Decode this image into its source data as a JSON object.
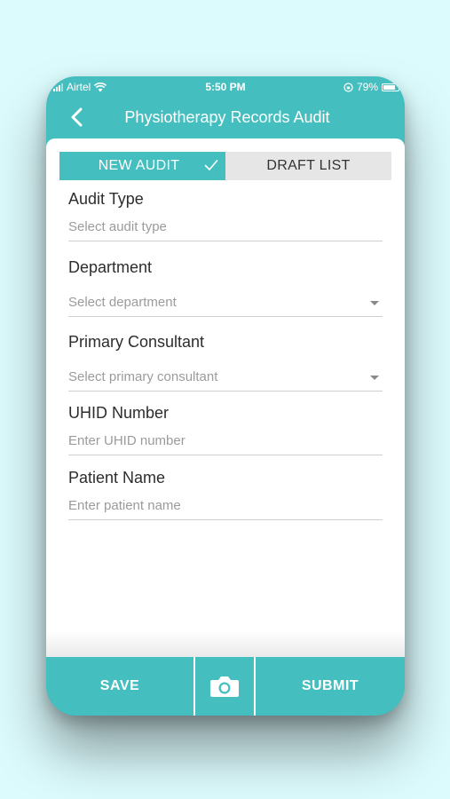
{
  "status_bar": {
    "carrier": "Airtel",
    "time": "5:50 PM",
    "battery": "79%",
    "battery_level": 0.79
  },
  "nav": {
    "title": "Physiotherapy Records Audit",
    "back_icon": "chevron-left-icon"
  },
  "tabs": {
    "new_audit": "NEW AUDIT",
    "draft_list": "DRAFT LIST",
    "active": "new_audit"
  },
  "form": {
    "audit_type": {
      "label": "Audit Type",
      "placeholder": "Select audit type"
    },
    "department": {
      "label": "Department",
      "placeholder": "Select department"
    },
    "primary_consultant": {
      "label": "Primary Consultant",
      "placeholder": "Select primary consultant"
    },
    "uhid": {
      "label": "UHID Number",
      "placeholder": "Enter UHID number"
    },
    "patient_name": {
      "label": "Patient Name",
      "placeholder": "Enter patient name"
    }
  },
  "bottom_bar": {
    "save": "SAVE",
    "camera_icon": "camera-icon",
    "submit": "SUBMIT"
  },
  "colors": {
    "accent": "#45bebf",
    "background": "#dcfbfd",
    "tab_inactive": "#e6e6e6",
    "placeholder": "#9b9b9b"
  }
}
